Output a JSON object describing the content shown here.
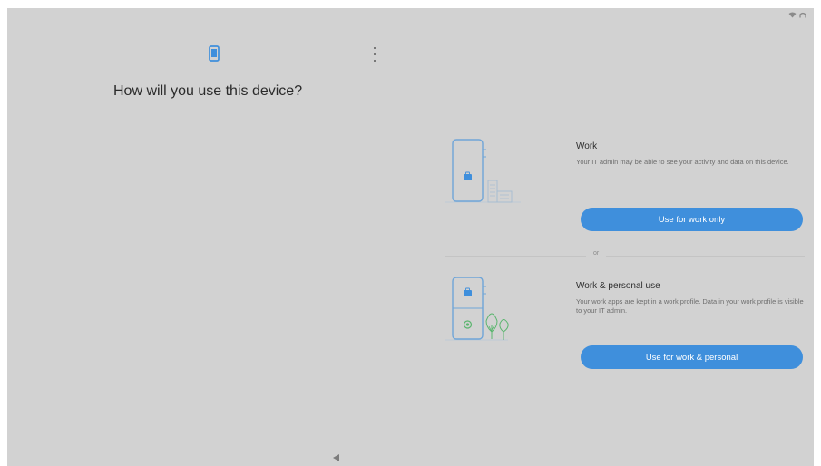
{
  "status_bar": {
    "icons": [
      "wifi-icon",
      "signal-icon"
    ]
  },
  "header": {
    "device_icon": "phone-icon",
    "menu_icon": "more-vertical-icon",
    "title": "How will you use this device?"
  },
  "options": {
    "work": {
      "title": "Work",
      "description": "Your IT admin may be able to see your activity and data on this device.",
      "button_label": "Use for work only",
      "illustration": "work-phone-building-illustration"
    },
    "divider_label": "or",
    "work_personal": {
      "title": "Work & personal use",
      "description": "Your work apps are kept in a work profile. Data in your work profile is visible to your IT admin.",
      "button_label": "Use for work & personal",
      "illustration": "work-personal-phone-tree-illustration"
    }
  },
  "navigation": {
    "back_icon": "back-triangle-icon"
  },
  "colors": {
    "background": "#d2d2d2",
    "accent": "#3f8fdc",
    "illustration_blue": "#6fa5d8",
    "illustration_green": "#5ab56e",
    "title_text": "#2b2b2b",
    "secondary_text": "#6e6e6e"
  }
}
